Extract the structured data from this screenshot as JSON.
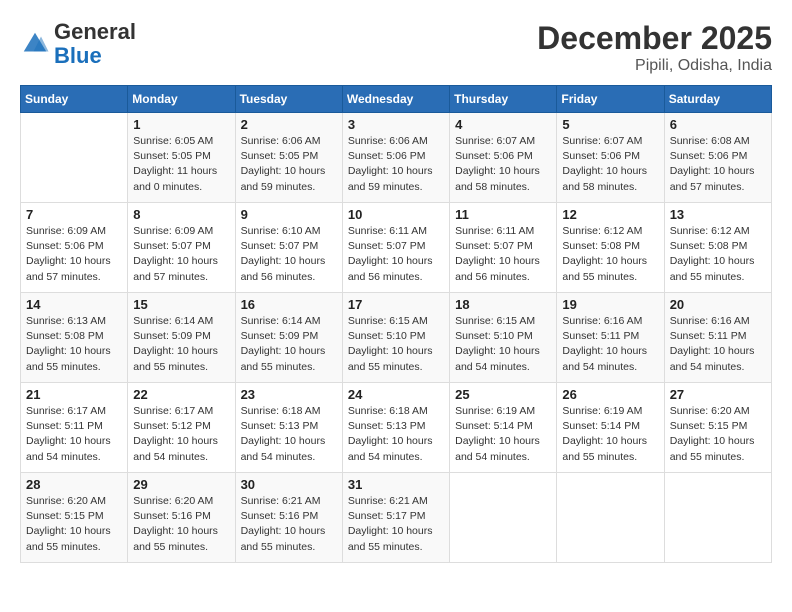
{
  "header": {
    "logo_general": "General",
    "logo_blue": "Blue",
    "month": "December 2025",
    "location": "Pipili, Odisha, India"
  },
  "columns": [
    "Sunday",
    "Monday",
    "Tuesday",
    "Wednesday",
    "Thursday",
    "Friday",
    "Saturday"
  ],
  "weeks": [
    [
      {
        "day": "",
        "info": ""
      },
      {
        "day": "1",
        "info": "Sunrise: 6:05 AM\nSunset: 5:05 PM\nDaylight: 11 hours\nand 0 minutes."
      },
      {
        "day": "2",
        "info": "Sunrise: 6:06 AM\nSunset: 5:05 PM\nDaylight: 10 hours\nand 59 minutes."
      },
      {
        "day": "3",
        "info": "Sunrise: 6:06 AM\nSunset: 5:06 PM\nDaylight: 10 hours\nand 59 minutes."
      },
      {
        "day": "4",
        "info": "Sunrise: 6:07 AM\nSunset: 5:06 PM\nDaylight: 10 hours\nand 58 minutes."
      },
      {
        "day": "5",
        "info": "Sunrise: 6:07 AM\nSunset: 5:06 PM\nDaylight: 10 hours\nand 58 minutes."
      },
      {
        "day": "6",
        "info": "Sunrise: 6:08 AM\nSunset: 5:06 PM\nDaylight: 10 hours\nand 57 minutes."
      }
    ],
    [
      {
        "day": "7",
        "info": "Sunrise: 6:09 AM\nSunset: 5:06 PM\nDaylight: 10 hours\nand 57 minutes."
      },
      {
        "day": "8",
        "info": "Sunrise: 6:09 AM\nSunset: 5:07 PM\nDaylight: 10 hours\nand 57 minutes."
      },
      {
        "day": "9",
        "info": "Sunrise: 6:10 AM\nSunset: 5:07 PM\nDaylight: 10 hours\nand 56 minutes."
      },
      {
        "day": "10",
        "info": "Sunrise: 6:11 AM\nSunset: 5:07 PM\nDaylight: 10 hours\nand 56 minutes."
      },
      {
        "day": "11",
        "info": "Sunrise: 6:11 AM\nSunset: 5:07 PM\nDaylight: 10 hours\nand 56 minutes."
      },
      {
        "day": "12",
        "info": "Sunrise: 6:12 AM\nSunset: 5:08 PM\nDaylight: 10 hours\nand 55 minutes."
      },
      {
        "day": "13",
        "info": "Sunrise: 6:12 AM\nSunset: 5:08 PM\nDaylight: 10 hours\nand 55 minutes."
      }
    ],
    [
      {
        "day": "14",
        "info": "Sunrise: 6:13 AM\nSunset: 5:08 PM\nDaylight: 10 hours\nand 55 minutes."
      },
      {
        "day": "15",
        "info": "Sunrise: 6:14 AM\nSunset: 5:09 PM\nDaylight: 10 hours\nand 55 minutes."
      },
      {
        "day": "16",
        "info": "Sunrise: 6:14 AM\nSunset: 5:09 PM\nDaylight: 10 hours\nand 55 minutes."
      },
      {
        "day": "17",
        "info": "Sunrise: 6:15 AM\nSunset: 5:10 PM\nDaylight: 10 hours\nand 55 minutes."
      },
      {
        "day": "18",
        "info": "Sunrise: 6:15 AM\nSunset: 5:10 PM\nDaylight: 10 hours\nand 54 minutes."
      },
      {
        "day": "19",
        "info": "Sunrise: 6:16 AM\nSunset: 5:11 PM\nDaylight: 10 hours\nand 54 minutes."
      },
      {
        "day": "20",
        "info": "Sunrise: 6:16 AM\nSunset: 5:11 PM\nDaylight: 10 hours\nand 54 minutes."
      }
    ],
    [
      {
        "day": "21",
        "info": "Sunrise: 6:17 AM\nSunset: 5:11 PM\nDaylight: 10 hours\nand 54 minutes."
      },
      {
        "day": "22",
        "info": "Sunrise: 6:17 AM\nSunset: 5:12 PM\nDaylight: 10 hours\nand 54 minutes."
      },
      {
        "day": "23",
        "info": "Sunrise: 6:18 AM\nSunset: 5:13 PM\nDaylight: 10 hours\nand 54 minutes."
      },
      {
        "day": "24",
        "info": "Sunrise: 6:18 AM\nSunset: 5:13 PM\nDaylight: 10 hours\nand 54 minutes."
      },
      {
        "day": "25",
        "info": "Sunrise: 6:19 AM\nSunset: 5:14 PM\nDaylight: 10 hours\nand 54 minutes."
      },
      {
        "day": "26",
        "info": "Sunrise: 6:19 AM\nSunset: 5:14 PM\nDaylight: 10 hours\nand 55 minutes."
      },
      {
        "day": "27",
        "info": "Sunrise: 6:20 AM\nSunset: 5:15 PM\nDaylight: 10 hours\nand 55 minutes."
      }
    ],
    [
      {
        "day": "28",
        "info": "Sunrise: 6:20 AM\nSunset: 5:15 PM\nDaylight: 10 hours\nand 55 minutes."
      },
      {
        "day": "29",
        "info": "Sunrise: 6:20 AM\nSunset: 5:16 PM\nDaylight: 10 hours\nand 55 minutes."
      },
      {
        "day": "30",
        "info": "Sunrise: 6:21 AM\nSunset: 5:16 PM\nDaylight: 10 hours\nand 55 minutes."
      },
      {
        "day": "31",
        "info": "Sunrise: 6:21 AM\nSunset: 5:17 PM\nDaylight: 10 hours\nand 55 minutes."
      },
      {
        "day": "",
        "info": ""
      },
      {
        "day": "",
        "info": ""
      },
      {
        "day": "",
        "info": ""
      }
    ]
  ]
}
